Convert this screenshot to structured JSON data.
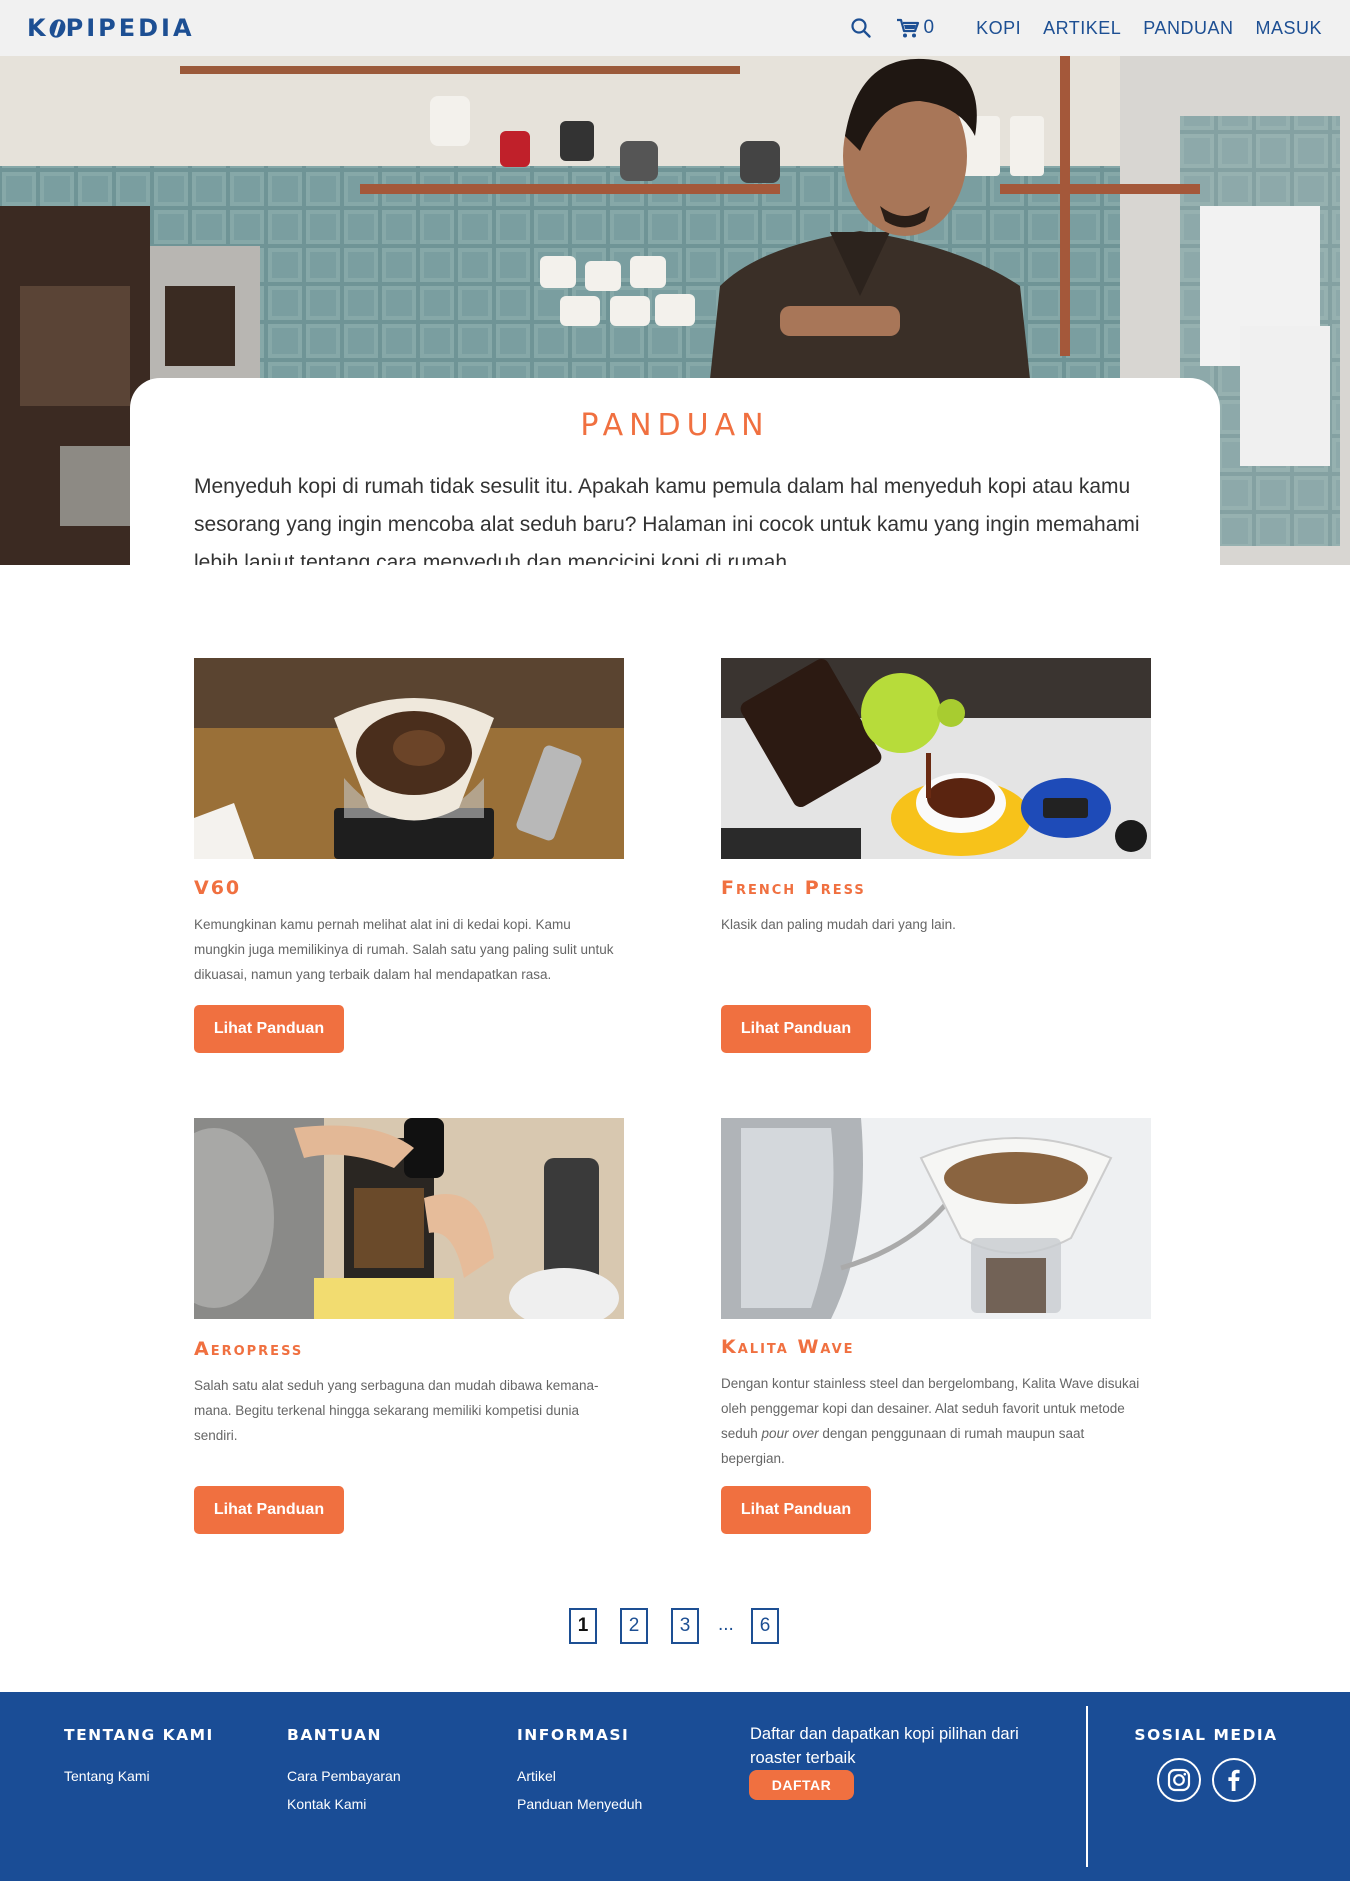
{
  "header": {
    "logo": "KOPIPEDIA",
    "cart_count": "0",
    "nav": [
      "KOPI",
      "ARTIKEL",
      "PANDUAN",
      "MASUK"
    ],
    "icons": {
      "search": "search-icon",
      "cart": "cart-icon"
    }
  },
  "hero": {
    "title": "PANDUAN",
    "intro": "Menyeduh kopi di rumah tidak sesulit itu. Apakah kamu pemula dalam hal menyeduh kopi atau kamu sesorang yang ingin mencoba alat seduh baru? Halaman ini cocok untuk kamu yang ingin memahami lebih lanjut tentang cara menyeduh dan mencicipi kopi di rumah."
  },
  "guides": [
    {
      "title": "V60",
      "description": "Kemungkinan kamu pernah melihat alat ini di kedai kopi. Kamu mungkin juga memilikinya di rumah. Salah satu yang paling sulit untuk dikuasai, namun yang terbaik dalam hal mendapatkan rasa.",
      "button": "Lihat Panduan"
    },
    {
      "title": "French Press",
      "description": "Klasik dan paling mudah dari yang lain.",
      "button": "Lihat Panduan"
    },
    {
      "title": "Aeropress",
      "description": "Salah satu alat seduh yang serbaguna dan mudah dibawa kemana-mana. Begitu terkenal hingga sekarang memiliki kompetisi dunia sendiri.",
      "button": "Lihat Panduan"
    },
    {
      "title": "Kalita Wave",
      "description_before": "Dengan kontur stainless steel dan bergelombang, Kalita Wave disukai oleh penggemar kopi dan desainer. Alat seduh favorit untuk metode seduh ",
      "description_em": "pour over",
      "description_after": " dengan penggunaan di rumah maupun saat bepergian.",
      "button": "Lihat Panduan"
    }
  ],
  "pagination": {
    "pages": [
      "1",
      "2",
      "3",
      "6"
    ],
    "ellipsis": "...",
    "current": "1"
  },
  "footer": {
    "about": {
      "heading": "TENTANG KAMI",
      "links": [
        "Tentang Kami"
      ]
    },
    "help": {
      "heading": "BANTUAN",
      "links": [
        "Cara Pembayaran",
        "Kontak Kami"
      ]
    },
    "info": {
      "heading": "INFORMASI",
      "links": [
        "Artikel",
        "Panduan Menyeduh"
      ]
    },
    "promo_text": "Daftar dan dapatkan kopi pilihan dari roaster terbaik",
    "signup_button": "DAFTAR",
    "social": {
      "heading": "SOSIAL MEDIA",
      "icons": [
        "instagram-icon",
        "facebook-icon"
      ]
    }
  },
  "colors": {
    "brand_blue": "#1d4f93",
    "footer_blue": "#1a4d96",
    "accent_orange": "#f07040",
    "header_bg": "#f1f1f1"
  }
}
